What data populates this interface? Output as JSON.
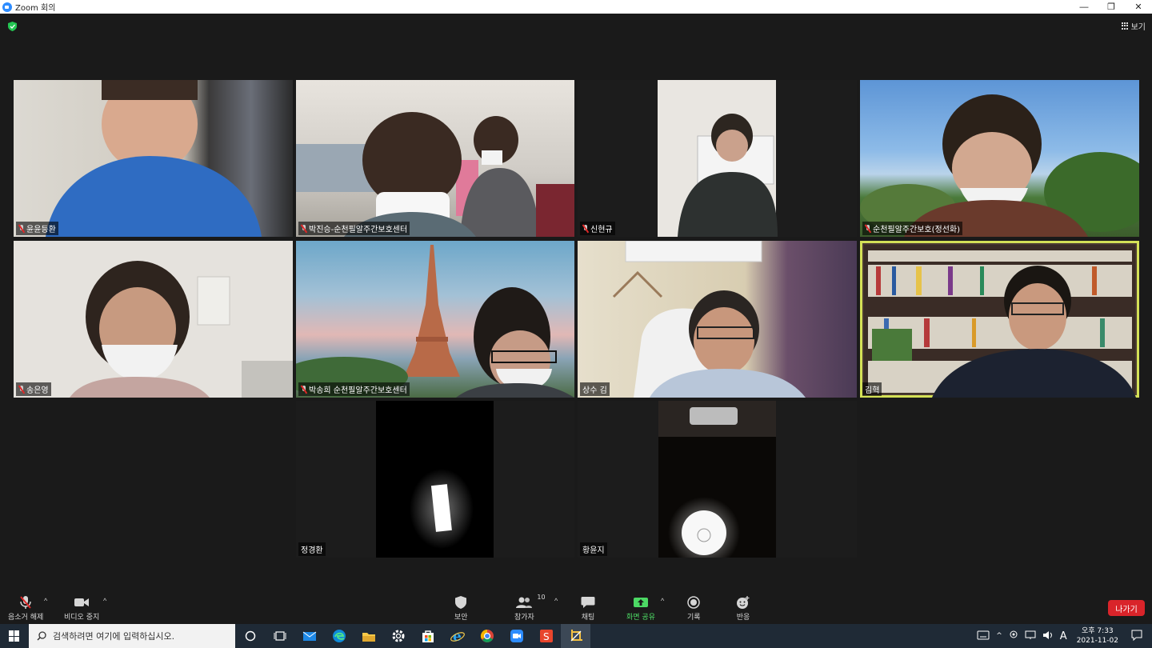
{
  "window": {
    "title": "Zoom 회의",
    "minimize": "—",
    "restore": "❐",
    "close": "✕"
  },
  "meeting": {
    "view_label": "보기",
    "participants": [
      {
        "name": "윤윤등환",
        "muted": true,
        "active": false
      },
      {
        "name": "박진승-순천필알주간보호센터",
        "muted": true,
        "active": false
      },
      {
        "name": "신현규",
        "muted": true,
        "active": false
      },
      {
        "name": "순천필알주간보호(정선화)",
        "muted": true,
        "active": false
      },
      {
        "name": "송은영",
        "muted": true,
        "active": false
      },
      {
        "name": "박송희 순천필알주간보호센터",
        "muted": true,
        "active": false
      },
      {
        "name": "상수 김",
        "muted": false,
        "active": false
      },
      {
        "name": "김혁",
        "muted": false,
        "active": true
      },
      {
        "name": "정경환",
        "muted": false,
        "active": false
      },
      {
        "name": "황윤지",
        "muted": false,
        "active": false
      }
    ]
  },
  "toolbar": {
    "unmute": "음소거 해제",
    "stop_video": "비디오 중지",
    "security": "보안",
    "participants": "참가자",
    "participants_count": "10",
    "chat": "채팅",
    "share_screen": "화면 공유",
    "record": "기록",
    "reactions": "반응",
    "leave": "나가기",
    "accent_green": "#4cd964",
    "leave_color": "#d9242a"
  },
  "taskbar": {
    "search_placeholder": "검색하려면 여기에 입력하십시오.",
    "time": "오후 7:33",
    "date": "2021-11-02",
    "lang": "A",
    "apps": [
      "cortana-icon",
      "task-view-icon",
      "mail-icon",
      "edge-icon",
      "file-explorer-icon",
      "settings-icon",
      "store-icon",
      "ie-icon",
      "chrome-icon",
      "zoom-icon",
      "app-s-icon",
      "snip-icon"
    ]
  }
}
